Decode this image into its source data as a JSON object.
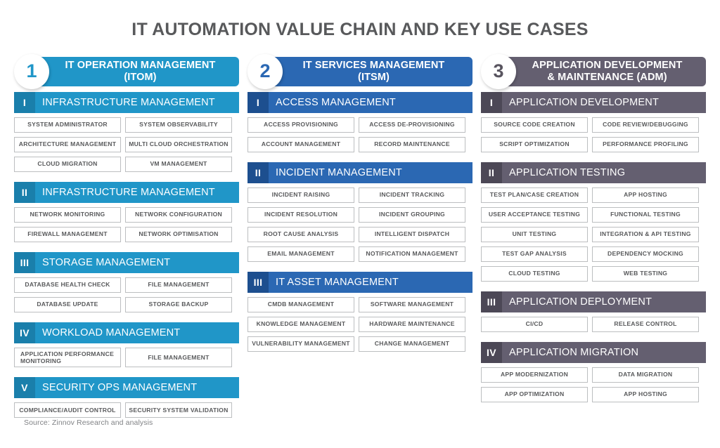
{
  "title": "IT AUTOMATION VALUE CHAIN AND KEY USE CASES",
  "source": "Source: Zinnov Research and analysis",
  "colors": {
    "col1_bar": "#2096c8",
    "col1_num": "#1a7fab",
    "col1_badge_text": "#2096c8",
    "col2_bar": "#2b68b3",
    "col2_num": "#1d4f8f",
    "col2_badge_text": "#2b68b3",
    "col3_bar": "#645f70",
    "col3_num": "#4c4856",
    "col3_badge_text": "#58545f",
    "item_border": "#bcbec0",
    "text": "#58595b",
    "source_text": "#808285"
  },
  "columns": [
    {
      "badge": "1",
      "title": "IT OPERATION MANAGEMENT\n(ITOM)",
      "sections": [
        {
          "numeral": "I",
          "label": "INFRASTRUCTURE MANAGEMENT",
          "items": [
            "SYSTEM ADMINISTRATOR",
            "SYSTEM OBSERVABILITY",
            "ARCHITECTURE MANAGEMENT",
            "MULTI CLOUD ORCHESTRATION",
            "CLOUD MIGRATION",
            "VM MANAGEMENT"
          ]
        },
        {
          "numeral": "II",
          "label": "INFRASTRUCTURE MANAGEMENT",
          "items": [
            "NETWORK MONITORING",
            "NETWORK CONFIGURATION",
            "FIREWALL MANAGEMENT",
            "NETWORK OPTIMISATION"
          ]
        },
        {
          "numeral": "III",
          "label": "STORAGE MANAGEMENT",
          "items": [
            "DATABASE HEALTH CHECK",
            "FILE MANAGEMENT",
            "DATABASE UPDATE",
            "STORAGE BACKUP"
          ]
        },
        {
          "numeral": "IV",
          "label": "WORKLOAD MANAGEMENT",
          "items": [
            "APPLICATION PERFORMANCE MONITORING",
            "FILE MANAGEMENT"
          ],
          "first_item_left": true
        },
        {
          "numeral": "V",
          "label": "SECURITY OPS MANAGEMENT",
          "items": [
            "COMPLIANCE/AUDIT CONTROL",
            "SECURITY SYSTEM VALIDATION"
          ]
        }
      ]
    },
    {
      "badge": "2",
      "title": "IT SERVICES MANAGEMENT\n(ITSM)",
      "sections": [
        {
          "numeral": "I",
          "label": "ACCESS MANAGEMENT",
          "items": [
            "ACCESS PROVISIONING",
            "ACCESS DE-PROVISIONING",
            "ACCOUNT MANAGEMENT",
            "RECORD MAINTENANCE"
          ]
        },
        {
          "numeral": "II",
          "label": "INCIDENT MANAGEMENT",
          "items": [
            "INCIDENT RAISING",
            "INCIDENT TRACKING",
            "INCIDENT RESOLUTION",
            "INCIDENT GROUPING",
            "ROOT CAUSE ANALYSIS",
            "INTELLIGENT DISPATCH",
            "EMAIL MANAGEMENT",
            "NOTIFICATION MANAGEMENT"
          ]
        },
        {
          "numeral": "III",
          "label": "IT ASSET MANAGEMENT",
          "items": [
            "CMDB MANAGEMENT",
            "SOFTWARE MANAGEMENT",
            "KNOWLEDGE MANAGEMENT",
            "HARDWARE MAINTENANCE",
            "VULNERABILITY MANAGEMENT",
            "CHANGE MANAGEMENT"
          ]
        }
      ]
    },
    {
      "badge": "3",
      "title": "APPLICATION DEVELOPMENT\n& MAINTENANCE (ADM)",
      "sections": [
        {
          "numeral": "I",
          "label": "APPLICATION DEVELOPMENT",
          "items": [
            "SOURCE CODE CREATION",
            "CODE REVIEW/DEBUGGING",
            "SCRIPT OPTIMIZATION",
            "PERFORMANCE PROFILING"
          ]
        },
        {
          "numeral": "II",
          "label": "APPLICATION TESTING",
          "items": [
            "TEST PLAN/CASE CREATION",
            "APP HOSTING",
            "USER ACCEPTANCE TESTING",
            "FUNCTIONAL TESTING",
            "UNIT TESTING",
            "INTEGRATION & API TESTING",
            "TEST GAP ANALYSIS",
            "DEPENDENCY MOCKING",
            "CLOUD TESTING",
            "WEB TESTING"
          ]
        },
        {
          "numeral": "III",
          "label": "APPLICATION DEPLOYMENT",
          "items": [
            "CI/CD",
            "RELEASE CONTROL"
          ]
        },
        {
          "numeral": "IV",
          "label": "APPLICATION MIGRATION",
          "items": [
            "APP MODERNIZATION",
            "DATA MIGRATION",
            "APP OPTIMIZATION",
            "APP HOSTING"
          ]
        }
      ]
    }
  ]
}
